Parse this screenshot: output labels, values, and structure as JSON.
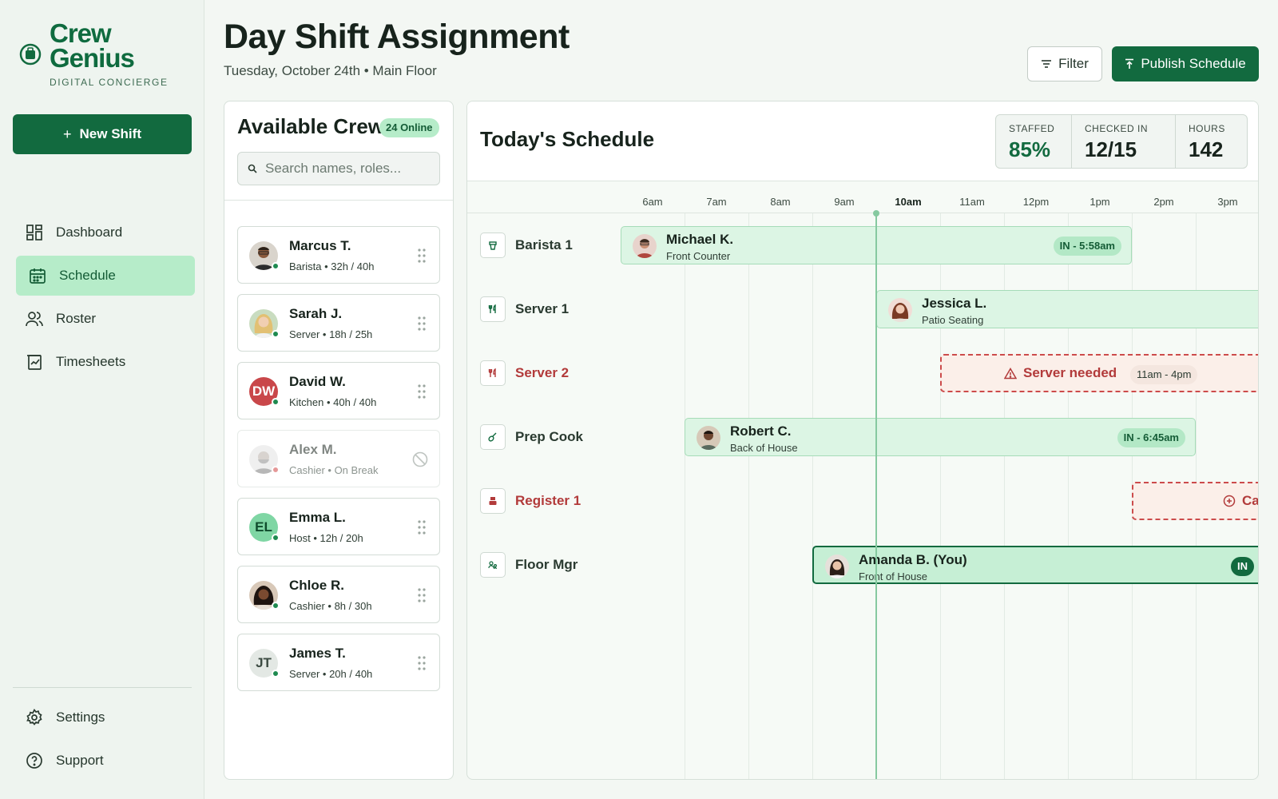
{
  "brand": {
    "name_line1": "Crew",
    "name_line2": "Genius",
    "tagline": "DIGITAL CONCIERGE",
    "accent": "#126a3f"
  },
  "sidebar": {
    "new_shift_label": "New Shift",
    "items": [
      {
        "label": "Dashboard",
        "icon": "dashboard-icon"
      },
      {
        "label": "Schedule",
        "icon": "calendar-icon",
        "active": true
      },
      {
        "label": "Roster",
        "icon": "people-icon"
      },
      {
        "label": "Timesheets",
        "icon": "timesheet-icon"
      }
    ],
    "bottom_items": [
      {
        "label": "Settings",
        "icon": "gear-icon"
      },
      {
        "label": "Support",
        "icon": "help-icon"
      }
    ]
  },
  "header": {
    "title": "Day Shift Assignment",
    "subtitle": "Tuesday, October 24th • Main Floor",
    "filter_label": "Filter",
    "publish_label": "Publish Schedule"
  },
  "crew": {
    "title": "Available Crew",
    "online_badge": "24 Online",
    "search_placeholder": "Search names, roles...",
    "members": [
      {
        "name": "Marcus T.",
        "meta": "Barista • 32h / 40h",
        "status": "online"
      },
      {
        "name": "Sarah J.",
        "meta": "Server • 18h / 25h",
        "status": "online"
      },
      {
        "name": "David W.",
        "meta": "Kitchen • 40h / 40h",
        "initials": "DW",
        "status": "online"
      },
      {
        "name": "Alex M.",
        "meta": "Cashier • On Break",
        "status": "break"
      },
      {
        "name": "Emma L.",
        "meta": "Host • 12h / 20h",
        "initials": "EL",
        "status": "online"
      },
      {
        "name": "Chloe R.",
        "meta": "Cashier • 8h / 30h",
        "status": "online"
      },
      {
        "name": "James T.",
        "meta": "Server • 20h / 40h",
        "initials": "JT",
        "status": "online"
      }
    ]
  },
  "schedule": {
    "title": "Today's Schedule",
    "stats": [
      {
        "label": "STAFFED",
        "value": "85%"
      },
      {
        "label": "CHECKED IN",
        "value": "12/15"
      },
      {
        "label": "HOURS",
        "value": "142"
      }
    ],
    "hours": [
      "6am",
      "7am",
      "8am",
      "9am",
      "10am",
      "11am",
      "12pm",
      "1pm",
      "2pm",
      "3pm"
    ],
    "current_hour": "10am",
    "lanes": [
      {
        "name": "Barista 1",
        "icon": "coffee-icon"
      },
      {
        "name": "Server 1",
        "icon": "utensils-icon"
      },
      {
        "name": "Server 2",
        "icon": "utensils-icon",
        "alert": true
      },
      {
        "name": "Prep Cook",
        "icon": "whisk-icon"
      },
      {
        "name": "Register 1",
        "icon": "register-icon",
        "alert": true
      },
      {
        "name": "Floor Mgr",
        "icon": "manager-icon"
      }
    ],
    "shifts": [
      {
        "name": "Michael K.",
        "area": "Front Counter",
        "check_in": "IN - 5:58am"
      },
      {
        "name": "Jessica L.",
        "area": "Patio Seating"
      },
      {
        "open_label": "Server needed",
        "time": "11am - 4pm"
      },
      {
        "name": "Robert C.",
        "area": "Back of House",
        "check_in": "IN - 6:45am"
      },
      {
        "open_label": "Ca"
      },
      {
        "name": "Amanda B. (You)",
        "area": "Front of House",
        "check_in": "IN"
      }
    ]
  }
}
